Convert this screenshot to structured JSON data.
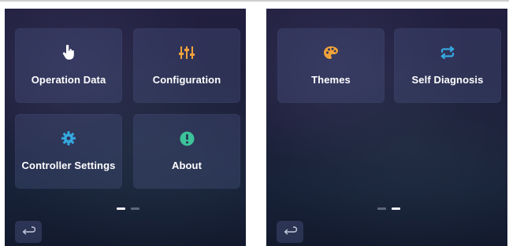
{
  "screens": [
    {
      "tiles": [
        {
          "label": "Operation Data",
          "icon": "hand-pointer-icon",
          "icon_color": "#ffffff"
        },
        {
          "label": "Configuration",
          "icon": "sliders-icon",
          "icon_color": "#f0a23a"
        },
        {
          "label": "Controller Settings",
          "icon": "gear-icon",
          "icon_color": "#35a8e0"
        },
        {
          "label": "About",
          "icon": "info-exclamation-icon",
          "icon_color": "#3cc39a"
        }
      ],
      "page_indicator": {
        "total": 2,
        "current": 1
      },
      "back_icon": "return-arrow-icon"
    },
    {
      "tiles": [
        {
          "label": "Themes",
          "icon": "palette-icon",
          "icon_color": "#f0a23a"
        },
        {
          "label": "Self Diagnosis",
          "icon": "swap-arrows-icon",
          "icon_color": "#35a8e0"
        }
      ],
      "page_indicator": {
        "total": 2,
        "current": 2
      },
      "back_icon": "return-arrow-icon"
    }
  ],
  "colors": {
    "tile_bg": "#3d4670",
    "screen_bg": "#1d1f3a",
    "text": "#ffffff",
    "orange_accent": "#f0a23a",
    "blue_accent": "#35a8e0",
    "green_accent": "#3cc39a"
  }
}
